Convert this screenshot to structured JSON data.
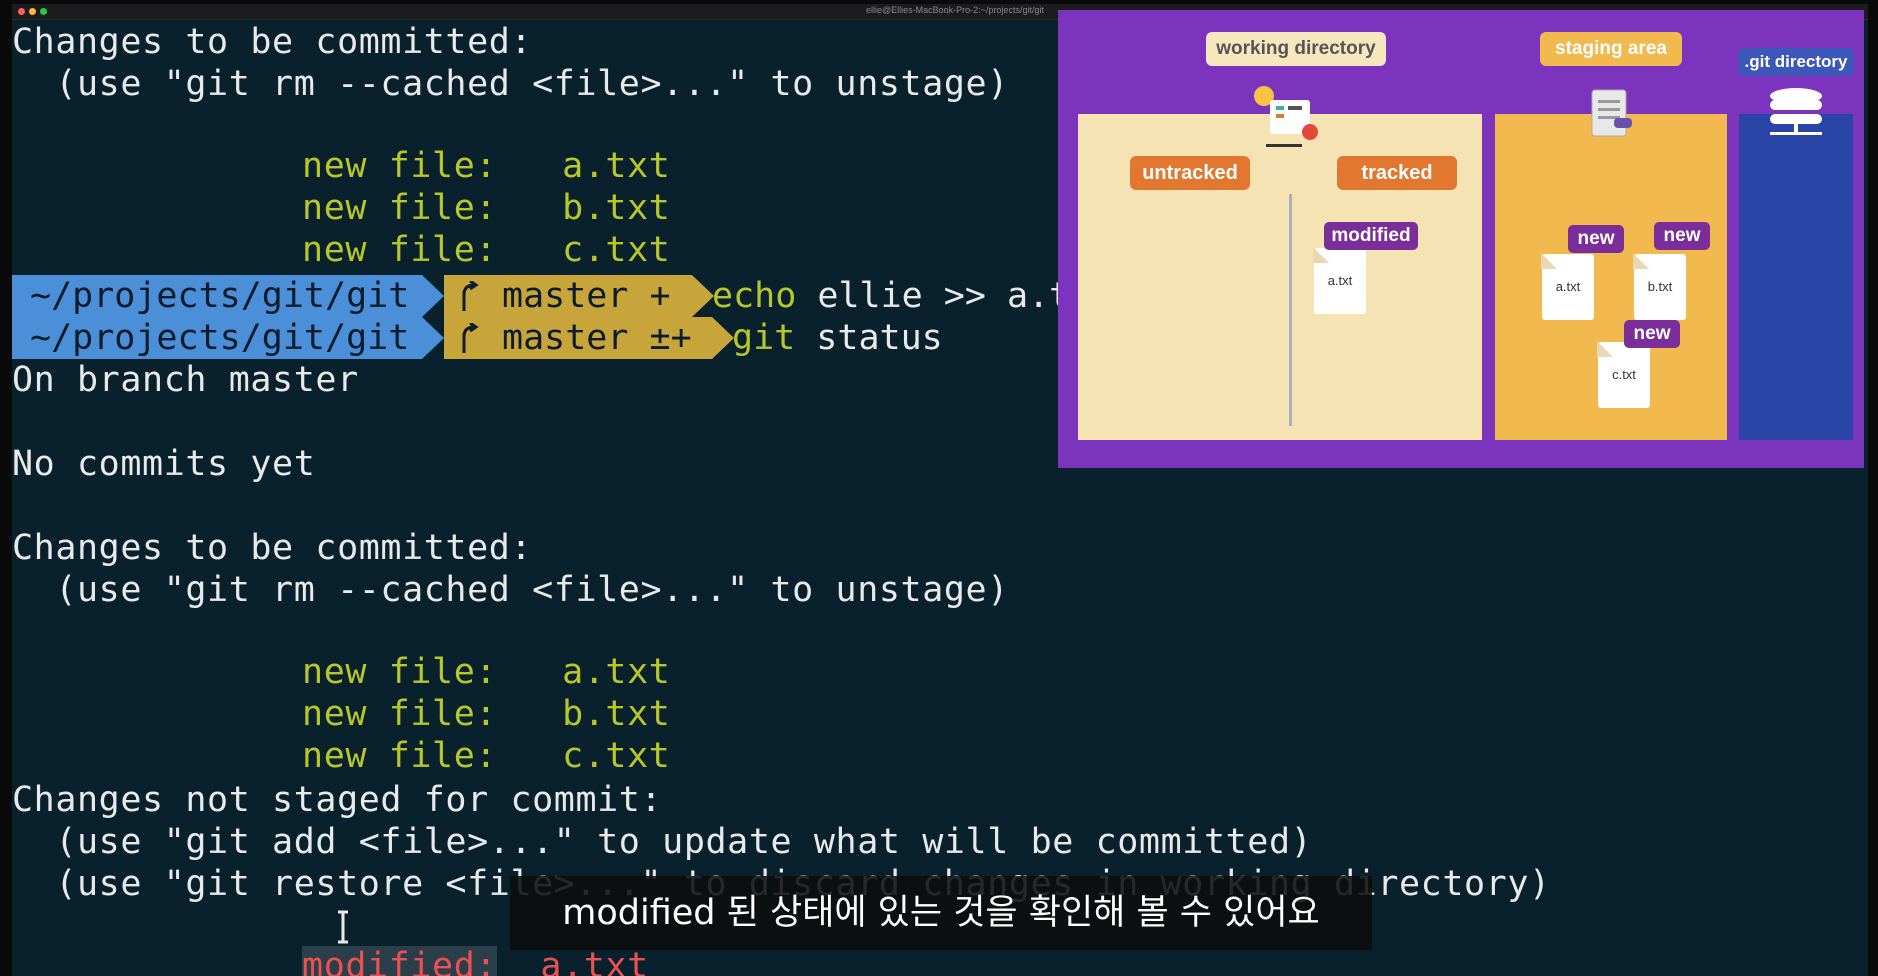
{
  "window": {
    "title": "ellie@Ellies-MacBook-Pro-2:~/projects/git/git",
    "traffic_lights": [
      "#ff5f57",
      "#febc2e",
      "#28c840"
    ]
  },
  "terminal": {
    "block1": {
      "header": "Changes to be committed:",
      "hint": "  (use \"git rm --cached <file>...\" to unstage)",
      "files": [
        {
          "status": "new file:",
          "name": "a.txt"
        },
        {
          "status": "new file:",
          "name": "b.txt"
        },
        {
          "status": "new file:",
          "name": "c.txt"
        }
      ]
    },
    "prompts": [
      {
        "path": "~/projects/git/git",
        "branch": "master +",
        "command_bin": "echo",
        "command_args": "ellie >> a.tx"
      },
      {
        "path": "~/projects/git/git",
        "branch": "master ±+",
        "command_bin": "git",
        "command_args": "status"
      }
    ],
    "status_output": {
      "on_branch": "On branch master",
      "no_commits": "No commits yet",
      "staged_header": "Changes to be committed:",
      "staged_hint": "  (use \"git rm --cached <file>...\" to unstage)",
      "staged_files": [
        {
          "status": "new file:",
          "name": "a.txt"
        },
        {
          "status": "new file:",
          "name": "b.txt"
        },
        {
          "status": "new file:",
          "name": "c.txt"
        }
      ],
      "unstaged_header": "Changes not staged for commit:",
      "unstaged_hint1": "  (use \"git add <file>...\" to update what will be committed)",
      "unstaged_hint2": "  (use \"git restore <file>...\" to discard changes in working directory)",
      "modified_label": "modified:",
      "modified_file": "a.txt"
    },
    "colors": {
      "background": "#08212d",
      "text": "#e9e9e9",
      "staged_green": "#b8c62a",
      "unstaged_red": "#ea5151",
      "path_segment": "#4a8fd8",
      "git_segment": "#c8a53a"
    }
  },
  "diagram": {
    "labels": {
      "working_directory": "working directory",
      "staging_area": "staging area",
      "git_directory": ".git directory",
      "untracked": "untracked",
      "tracked": "tracked"
    },
    "working_files": [
      {
        "badge": "modified",
        "name": "a.txt"
      }
    ],
    "staging_files": [
      {
        "badge": "new",
        "name": "a.txt"
      },
      {
        "badge": "new",
        "name": "b.txt"
      },
      {
        "badge": "new",
        "name": "c.txt"
      }
    ],
    "colors": {
      "background": "#7c34be",
      "working_panel": "#f6e3b4",
      "staging_panel": "#f2b94e",
      "git_panel": "#2a45a8",
      "badge": "#7b2d9a"
    }
  },
  "subtitle": "modified 된 상태에 있는 것을 확인해 볼 수 있어요"
}
